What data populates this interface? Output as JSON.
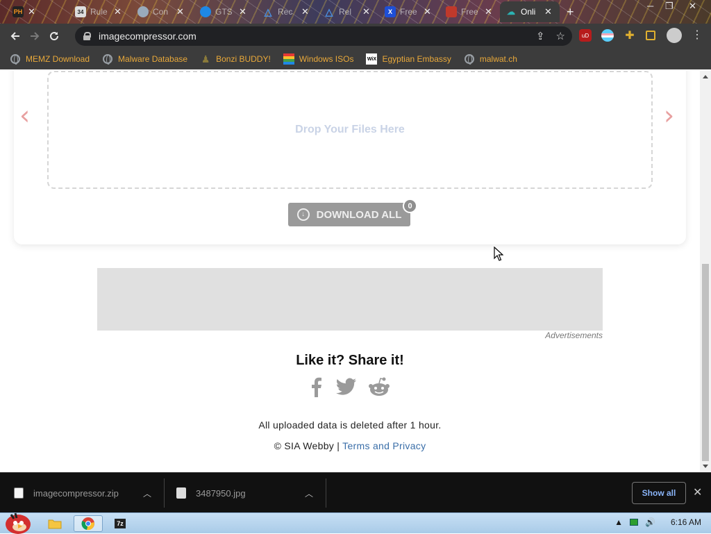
{
  "browser": {
    "tabs": [
      {
        "label": "PH",
        "icon": "ph-icon",
        "color": "#f7931e"
      },
      {
        "label": "Rule",
        "icon": "rule34-icon",
        "color": "#2b7a2b"
      },
      {
        "label": "Con",
        "icon": "con-icon",
        "color": "#9ab"
      },
      {
        "label": "GTS",
        "icon": "gts-icon",
        "color": "#1e88e5"
      },
      {
        "label": "Rec",
        "icon": "recaptcha-icon",
        "color": "#4a90e2"
      },
      {
        "label": "Rel",
        "icon": "rel-icon",
        "color": "#4a90e2"
      },
      {
        "label": "Free",
        "icon": "x-icon",
        "color": "#1e4fd6"
      },
      {
        "label": "Free",
        "icon": "free-icon",
        "color": "#c0392b"
      },
      {
        "label": "Onli",
        "icon": "imagecompressor-icon",
        "color": "#2bb3b3",
        "active": true
      }
    ],
    "new_tab": "+",
    "url": "imagecompressor.com",
    "bookmarks": [
      {
        "label": "MEMZ Download",
        "icon": "globe-icon"
      },
      {
        "label": "Malware Database",
        "icon": "globe-icon"
      },
      {
        "label": "Bonzi BUDDY!",
        "icon": "bonzi-icon"
      },
      {
        "label": "Windows ISOs",
        "icon": "windows-flag-icon"
      },
      {
        "label": "Egyptian Embassy",
        "icon": "wix-icon"
      },
      {
        "label": "malwat.ch",
        "icon": "globe-icon"
      }
    ]
  },
  "page": {
    "dropzone_text": "Drop Your Files Here",
    "download_all_label": "DOWNLOAD ALL",
    "download_count": "0",
    "ad_label": "Advertisements",
    "share_title": "Like it? Share it!",
    "deleted_notice": "All uploaded data is deleted after 1 hour.",
    "copyright_prefix": "© SIA Webby | ",
    "terms_link": "Terms and Privacy"
  },
  "downloads": {
    "items": [
      {
        "name": "imagecompressor.zip",
        "icon": "zip-file-icon"
      },
      {
        "name": "3487950.jpg",
        "icon": "image-file-icon"
      }
    ],
    "show_all_label": "Show all"
  },
  "taskbar": {
    "clock": "6:16 AM"
  }
}
